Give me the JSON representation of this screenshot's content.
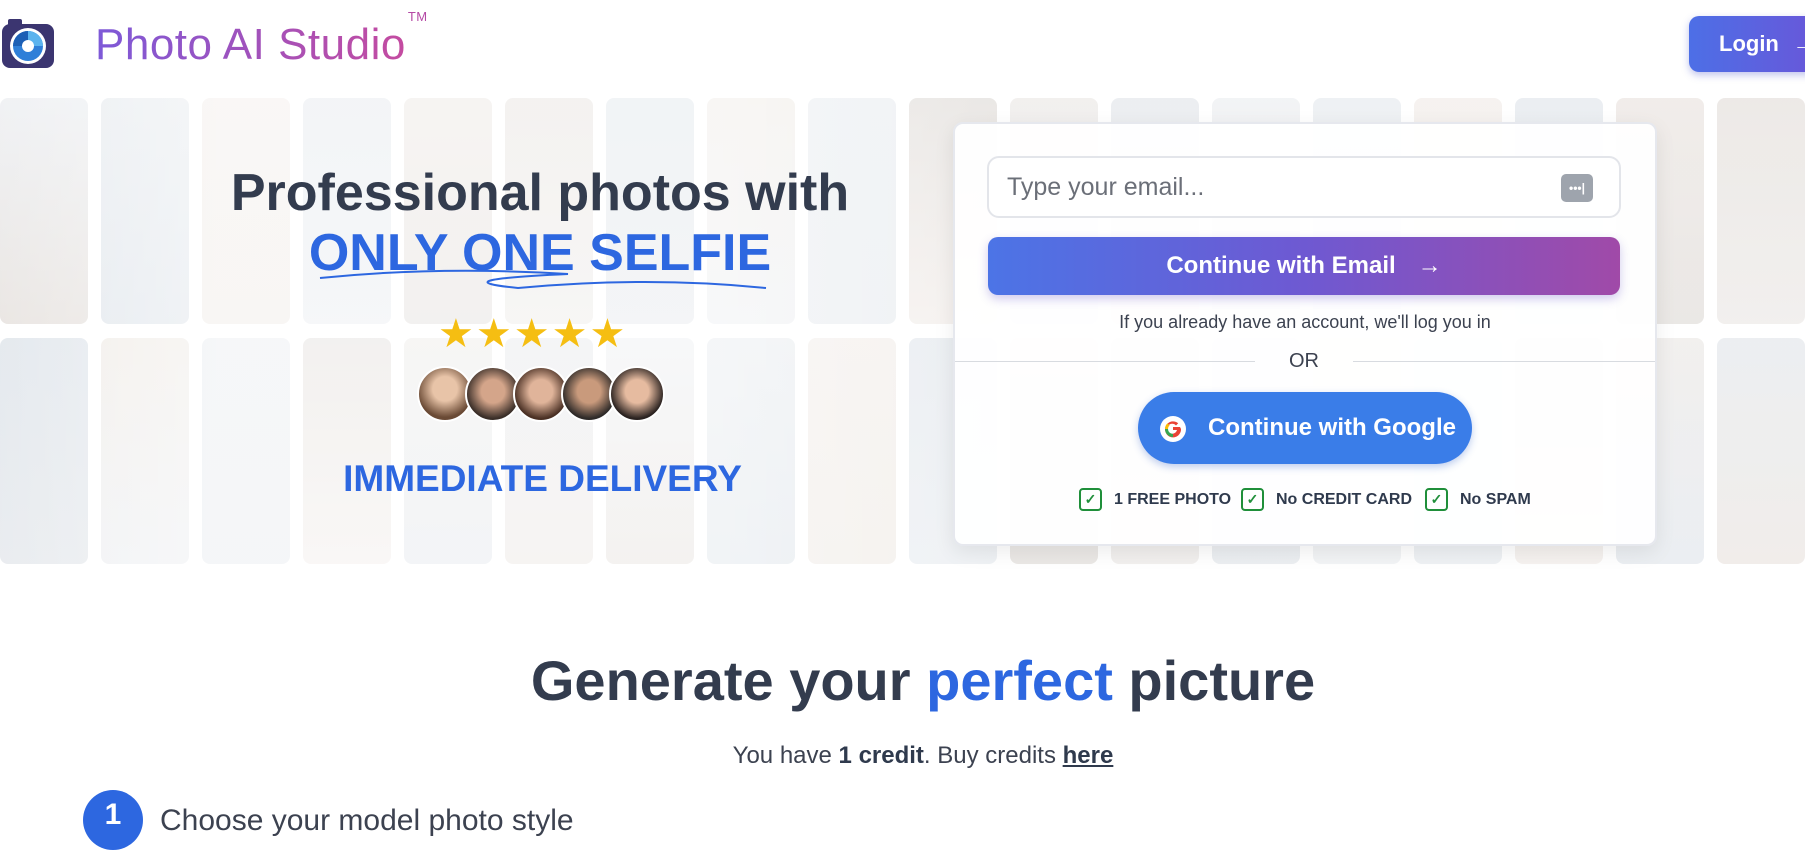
{
  "header": {
    "brand": "Photo AI Studio",
    "trademark": "TM",
    "login_label": "Login",
    "login_arrow": "→"
  },
  "hero": {
    "title_line1": "Professional photos with",
    "title_line2": "ONLY ONE SELFIE",
    "stars": "★★★★★",
    "rating": 5,
    "delivery": "IMMEDIATE DELIVERY"
  },
  "signup": {
    "email_placeholder": "Type your email...",
    "email_button": "Continue with Email",
    "email_button_arrow": "→",
    "note": "If you already have an account, we'll log you in",
    "or": "OR",
    "google_button": "Continue with Google",
    "badges": [
      "1 FREE PHOTO",
      "No CREDIT CARD",
      "No SPAM"
    ]
  },
  "generate": {
    "title_part1": "Generate your ",
    "title_accent": "perfect",
    "title_part2": " picture",
    "credits_prefix": "You have ",
    "credits_value": "1 credit",
    "credits_middle": ". Buy credits ",
    "credits_link": "here",
    "step_number": "1",
    "step_text": "Choose your model photo style"
  },
  "colors": {
    "accent_blue": "#2d67e0",
    "brand_gradient_start": "#7d59d8",
    "brand_gradient_end": "#c94a9c",
    "star_yellow": "#f5be12",
    "check_green": "#1f8f3a"
  }
}
